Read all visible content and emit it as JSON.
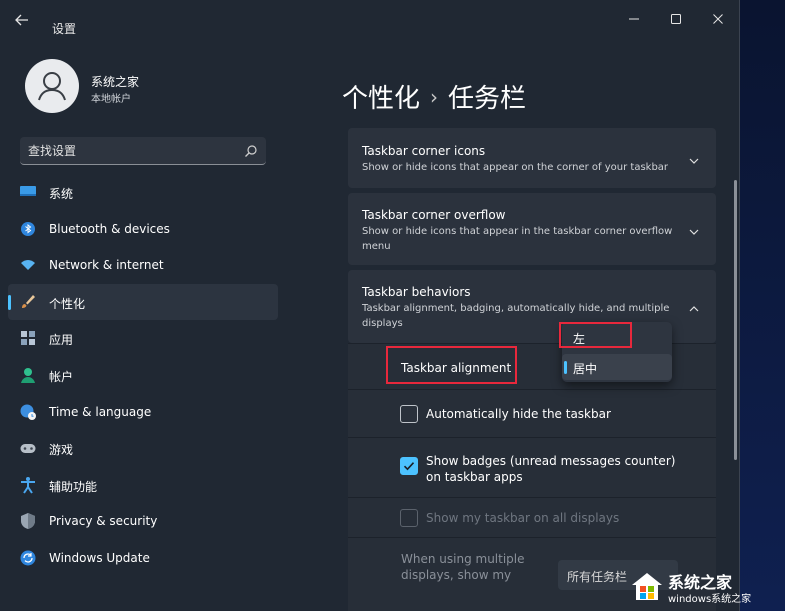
{
  "window": {
    "app_title": "设置"
  },
  "account": {
    "name": "系统之家",
    "type": "本地帐户"
  },
  "search": {
    "placeholder": "查找设置"
  },
  "nav": {
    "items": [
      {
        "label": "系统",
        "icon": "monitor-icon",
        "active": false
      },
      {
        "label": "Bluetooth & devices",
        "icon": "bluetooth-icon",
        "active": false
      },
      {
        "label": "Network & internet",
        "icon": "wifi-icon",
        "active": false
      },
      {
        "label": "个性化",
        "icon": "brush-icon",
        "active": true
      },
      {
        "label": "应用",
        "icon": "apps-icon",
        "active": false
      },
      {
        "label": "帐户",
        "icon": "person-icon",
        "active": false
      },
      {
        "label": "Time & language",
        "icon": "globe-clock-icon",
        "active": false
      },
      {
        "label": "游戏",
        "icon": "gamepad-icon",
        "active": false
      },
      {
        "label": "辅助功能",
        "icon": "accessibility-icon",
        "active": false
      },
      {
        "label": "Privacy & security",
        "icon": "shield-icon",
        "active": false
      },
      {
        "label": "Windows Update",
        "icon": "update-icon",
        "active": false
      }
    ]
  },
  "header": {
    "section": "个性化",
    "separator": "›",
    "page": "任务栏"
  },
  "cards": {
    "corner_icons": {
      "title": "Taskbar corner icons",
      "desc": "Show or hide icons that appear on the corner of your taskbar"
    },
    "corner_overflow": {
      "title": "Taskbar corner overflow",
      "desc": "Show or hide icons that appear in the taskbar corner overflow menu"
    },
    "behaviors": {
      "title": "Taskbar behaviors",
      "desc": "Taskbar alignment, badging, automatically hide, and multiple displays"
    }
  },
  "behaviors": {
    "alignment_label": "Taskbar alignment",
    "alignment_options": [
      "左",
      "居中"
    ],
    "alignment_selected": "居中",
    "auto_hide": {
      "label": "Automatically hide the taskbar",
      "checked": false
    },
    "badges": {
      "label_line1": "Show badges (unread messages counter)",
      "label_line2": "on taskbar apps",
      "checked": true
    },
    "all_displays": {
      "label": "Show my taskbar on all displays",
      "checked": false,
      "disabled": true
    },
    "multi_display": {
      "label_line1": "When using multiple",
      "label_line2": "displays, show my",
      "value": "所有任务栏"
    }
  },
  "watermark": {
    "text": "系统之家",
    "site": "windows系统之家"
  },
  "colors": {
    "accent": "#4cc2ff",
    "highlight_box": "#e8283c"
  }
}
